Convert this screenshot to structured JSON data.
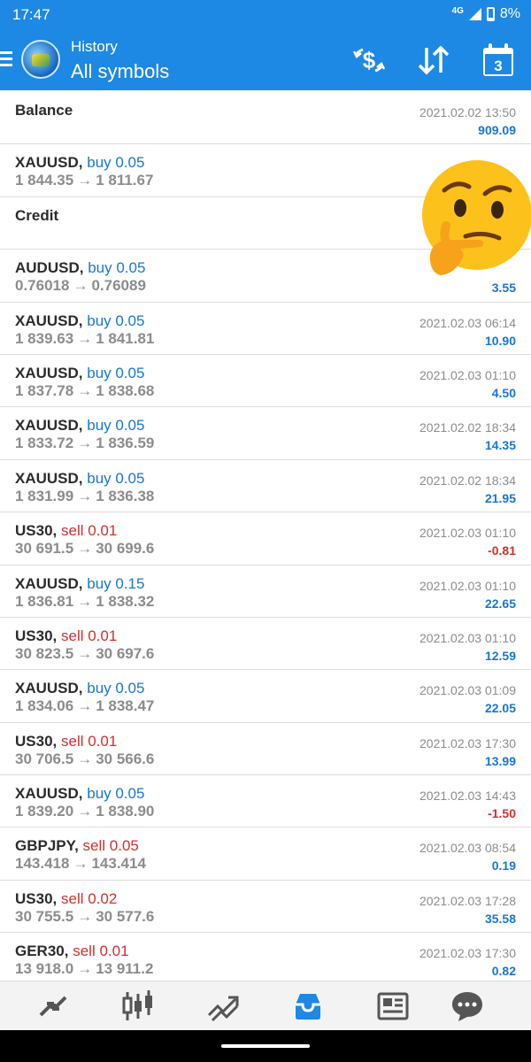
{
  "status_bar": {
    "time": "17:47",
    "network": "4G",
    "battery": "8%"
  },
  "app_bar": {
    "subtitle": "History",
    "title": "All symbols",
    "calendar_day": "3"
  },
  "rows": [
    {
      "symbol": "Balance",
      "side": "",
      "side_type": "",
      "prices": null,
      "date": "2021.02.02 13:50",
      "profit": "909.09",
      "profit_type": "pos"
    },
    {
      "symbol": "XAUUSD,",
      "side": "buy 0.05",
      "side_type": "buy",
      "open_price": "1 844.35",
      "close_price": "1 811.67",
      "date": "",
      "profit": "",
      "profit_type": "pos"
    },
    {
      "symbol": "Credit",
      "side": "",
      "side_type": "",
      "prices": null,
      "date": "",
      "profit": "",
      "profit_type": "pos"
    },
    {
      "symbol": "AUDUSD,",
      "side": "buy 0.05",
      "side_type": "buy",
      "open_price": "0.76018",
      "close_price": "0.76089",
      "date": "",
      "profit": "3.55",
      "profit_type": "pos"
    },
    {
      "symbol": "XAUUSD,",
      "side": "buy 0.05",
      "side_type": "buy",
      "open_price": "1 839.63",
      "close_price": "1 841.81",
      "date": "2021.02.03 06:14",
      "profit": "10.90",
      "profit_type": "pos"
    },
    {
      "symbol": "XAUUSD,",
      "side": "buy 0.05",
      "side_type": "buy",
      "open_price": "1 837.78",
      "close_price": "1 838.68",
      "date": "2021.02.03 01:10",
      "profit": "4.50",
      "profit_type": "pos"
    },
    {
      "symbol": "XAUUSD,",
      "side": "buy 0.05",
      "side_type": "buy",
      "open_price": "1 833.72",
      "close_price": "1 836.59",
      "date": "2021.02.02 18:34",
      "profit": "14.35",
      "profit_type": "pos"
    },
    {
      "symbol": "XAUUSD,",
      "side": "buy 0.05",
      "side_type": "buy",
      "open_price": "1 831.99",
      "close_price": "1 836.38",
      "date": "2021.02.02 18:34",
      "profit": "21.95",
      "profit_type": "pos"
    },
    {
      "symbol": "US30,",
      "side": "sell 0.01",
      "side_type": "sell",
      "open_price": "30 691.5",
      "close_price": "30 699.6",
      "date": "2021.02.03 01:10",
      "profit": "-0.81",
      "profit_type": "neg"
    },
    {
      "symbol": "XAUUSD,",
      "side": "buy 0.15",
      "side_type": "buy",
      "open_price": "1 836.81",
      "close_price": "1 838.32",
      "date": "2021.02.03 01:10",
      "profit": "22.65",
      "profit_type": "pos"
    },
    {
      "symbol": "US30,",
      "side": "sell 0.01",
      "side_type": "sell",
      "open_price": "30 823.5",
      "close_price": "30 697.6",
      "date": "2021.02.03 01:10",
      "profit": "12.59",
      "profit_type": "pos"
    },
    {
      "symbol": "XAUUSD,",
      "side": "buy 0.05",
      "side_type": "buy",
      "open_price": "1 834.06",
      "close_price": "1 838.47",
      "date": "2021.02.03 01:09",
      "profit": "22.05",
      "profit_type": "pos"
    },
    {
      "symbol": "US30,",
      "side": "sell 0.01",
      "side_type": "sell",
      "open_price": "30 706.5",
      "close_price": "30 566.6",
      "date": "2021.02.03 17:30",
      "profit": "13.99",
      "profit_type": "pos"
    },
    {
      "symbol": "XAUUSD,",
      "side": "buy 0.05",
      "side_type": "buy",
      "open_price": "1 839.20",
      "close_price": "1 838.90",
      "date": "2021.02.03 14:43",
      "profit": "-1.50",
      "profit_type": "neg"
    },
    {
      "symbol": "GBPJPY,",
      "side": "sell 0.05",
      "side_type": "sell",
      "open_price": "143.418",
      "close_price": "143.414",
      "date": "2021.02.03 08:54",
      "profit": "0.19",
      "profit_type": "pos"
    },
    {
      "symbol": "US30,",
      "side": "sell 0.02",
      "side_type": "sell",
      "open_price": "30 755.5",
      "close_price": "30 577.6",
      "date": "2021.02.03 17:28",
      "profit": "35.58",
      "profit_type": "pos"
    },
    {
      "symbol": "GER30,",
      "side": "sell 0.01",
      "side_type": "sell",
      "open_price": "13 918.0",
      "close_price": "13 911.2",
      "date": "2021.02.03 17:30",
      "profit": "0.82",
      "profit_type": "pos"
    }
  ],
  "price_arrow": "→",
  "bottom_nav": [
    "quotes-icon",
    "chart-icon",
    "trade-icon",
    "history-icon",
    "news-icon",
    "chat-icon"
  ],
  "active_tab": "history-icon",
  "overlay": "thinking-face-emoji",
  "colors": {
    "accent": "#1e88e5",
    "buy": "#1976d2",
    "sell": "#d32f2f"
  }
}
